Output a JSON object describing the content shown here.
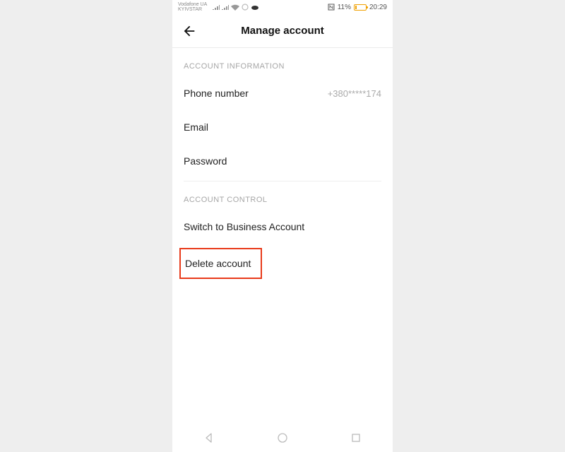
{
  "status": {
    "carrier1": "Vodafone UA",
    "carrier2": "KYIVSTAR",
    "battery_pct": "11%",
    "time": "20:29"
  },
  "header": {
    "title": "Manage account"
  },
  "sections": {
    "info_header": "ACCOUNT INFORMATION",
    "control_header": "ACCOUNT CONTROL"
  },
  "rows": {
    "phone_label": "Phone number",
    "phone_value": "+380*****174",
    "email_label": "Email",
    "password_label": "Password",
    "switch_label": "Switch to Business Account",
    "delete_label": "Delete account"
  }
}
